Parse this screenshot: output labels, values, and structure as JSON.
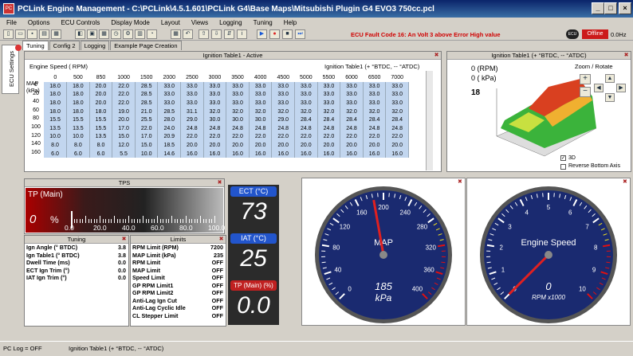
{
  "window": {
    "title": "PCLink Engine Management - C:\\PCLink\\4.5.1.601\\PCLink G4\\Base Maps\\Mitsubishi Plugin G4 EVO3 750cc.pcl",
    "app_icon": "PC"
  },
  "menu": [
    "File",
    "Options",
    "ECU Controls",
    "Display Mode",
    "Layout",
    "Views",
    "Logging",
    "Tuning",
    "Help"
  ],
  "toolbar": {
    "fault": "ECU Fault Code 16: An Volt 3 above Error High value",
    "status": "Offline",
    "rate": "0.0Hz",
    "ecu_icon": "ECU"
  },
  "tabs": [
    "Tuning",
    "Config 2",
    "Logging",
    "Example Page Creation"
  ],
  "side_tab": "ECU Settings",
  "ign_table": {
    "title": "Ignition Table1 - Active",
    "axis_label": "Engine Speed ( RPM)",
    "right_label": "Ignition Table1 (+ °BTDC, -- °ATDC)",
    "load_label": "MAP (kPa)",
    "rpm": [
      "0",
      "500",
      "850",
      "1000",
      "1500",
      "2000",
      "2500",
      "3000",
      "3500",
      "4000",
      "4500",
      "5000",
      "5500",
      "6000",
      "6500",
      "7000"
    ],
    "loads": [
      "0",
      "20",
      "40",
      "60",
      "80",
      "100",
      "120",
      "140",
      "160"
    ],
    "rows": [
      [
        "18.0",
        "18.0",
        "20.0",
        "22.0",
        "28.5",
        "33.0",
        "33.0",
        "33.0",
        "33.0",
        "33.0",
        "33.0",
        "33.0",
        "33.0",
        "33.0",
        "33.0",
        "33.0"
      ],
      [
        "18.0",
        "18.0",
        "20.0",
        "22.0",
        "28.5",
        "33.0",
        "33.0",
        "33.0",
        "33.0",
        "33.0",
        "33.0",
        "33.0",
        "33.0",
        "33.0",
        "33.0",
        "33.0"
      ],
      [
        "18.0",
        "18.0",
        "20.0",
        "22.0",
        "28.5",
        "33.0",
        "33.0",
        "33.0",
        "33.0",
        "33.0",
        "33.0",
        "33.0",
        "33.0",
        "33.0",
        "33.0",
        "33.0"
      ],
      [
        "18.0",
        "18.0",
        "18.0",
        "19.0",
        "21.0",
        "28.5",
        "31.1",
        "32.0",
        "32.0",
        "32.0",
        "32.0",
        "32.0",
        "32.0",
        "32.0",
        "32.0",
        "32.0"
      ],
      [
        "15.5",
        "15.5",
        "15.5",
        "20.0",
        "25.5",
        "28.0",
        "29.0",
        "30.0",
        "30.0",
        "30.0",
        "29.0",
        "28.4",
        "28.4",
        "28.4",
        "28.4",
        "28.4"
      ],
      [
        "13.5",
        "13.5",
        "15.5",
        "17.0",
        "22.0",
        "24.0",
        "24.8",
        "24.8",
        "24.8",
        "24.8",
        "24.8",
        "24.8",
        "24.8",
        "24.8",
        "24.8",
        "24.8"
      ],
      [
        "10.0",
        "10.0",
        "13.5",
        "15.0",
        "17.0",
        "20.9",
        "22.0",
        "22.0",
        "22.0",
        "22.0",
        "22.0",
        "22.0",
        "22.0",
        "22.0",
        "22.0",
        "22.0"
      ],
      [
        "8.0",
        "8.0",
        "8.0",
        "12.0",
        "15.0",
        "18.5",
        "20.0",
        "20.0",
        "20.0",
        "20.0",
        "20.0",
        "20.0",
        "20.0",
        "20.0",
        "20.0",
        "20.0"
      ],
      [
        "6.0",
        "6.0",
        "6.0",
        "5.5",
        "10.0",
        "14.6",
        "16.0",
        "16.0",
        "16.0",
        "16.0",
        "16.0",
        "16.0",
        "16.0",
        "16.0",
        "16.0",
        "16.0"
      ]
    ]
  },
  "view3d": {
    "title": "Ignition Table1 (+ °BTDC, -- °ATDC)",
    "rpm_read": "0 (RPM)",
    "kpa_read": "0 ( kPa)",
    "value_read": "18",
    "zoom_label": "Zoom / Rotate",
    "plus": "+",
    "minus": "−",
    "up": "▲",
    "down": "▼",
    "left": "◀",
    "right": "▶",
    "chk3d": "3D",
    "chk_axis": "Reverse Bottom Axis"
  },
  "tps": {
    "title": "TPS",
    "label": "TP (Main)",
    "value": "0",
    "unit": "%",
    "ticks": [
      "0.0",
      "20.0",
      "40.0",
      "60.0",
      "80.0",
      "100.0"
    ],
    "level": 0
  },
  "tuning": {
    "title": "Tuning",
    "rows": [
      {
        "label": "Ign Angle (° BTDC)",
        "value": "3.8"
      },
      {
        "label": "Ign Table1 (° BTDC)",
        "value": "3.8"
      },
      {
        "label": "Dwell Time (ms)",
        "value": "0.0"
      },
      {
        "label": "ECT Ign Trim (°)",
        "value": "0.0"
      },
      {
        "label": "IAT Ign Trim (°)",
        "value": "0.0"
      }
    ]
  },
  "limits": {
    "title": "Limits",
    "rows": [
      {
        "label": "RPM Limit (RPM)",
        "value": "7200"
      },
      {
        "label": "MAP Limit (kPa)",
        "value": "235"
      },
      {
        "label": "RPM Limit",
        "value": "OFF"
      },
      {
        "label": "MAP Limit",
        "value": "OFF"
      },
      {
        "label": "Speed Limit",
        "value": "OFF"
      },
      {
        "label": "GP RPM Limit1",
        "value": "OFF"
      },
      {
        "label": "GP RPM Limit2",
        "value": "OFF"
      },
      {
        "label": "Anti-Lag Ign Cut",
        "value": "OFF"
      },
      {
        "label": "Anti-Lag Cyclic Idle",
        "value": "OFF"
      },
      {
        "label": "CL Stepper Limit",
        "value": "OFF"
      }
    ]
  },
  "big": {
    "ect_label": "ECT (°C)",
    "ect_value": "73",
    "iat_label": "IAT (°C)",
    "iat_value": "25",
    "tp_label": "TP (Main) (%)",
    "tp_value": "0.0"
  },
  "map_gauge": {
    "name": "MAP",
    "value": "185",
    "unit": "kPa",
    "ticks": [
      "0",
      "40",
      "80",
      "120",
      "160",
      "200",
      "240",
      "280",
      "320",
      "360",
      "400"
    ],
    "max": 400,
    "reading": 185
  },
  "rpm_gauge": {
    "name": "Engine Speed",
    "value": "0",
    "unit": "RPM x1000",
    "ticks": [
      "0",
      "1",
      "2",
      "3",
      "4",
      "5",
      "6",
      "7",
      "8",
      "9",
      "10"
    ],
    "max": 10,
    "reading": 0
  },
  "statusbar": {
    "log": "PC Log = OFF",
    "table": "Ignition Table1 (+ °BTDC, -- °ATDC)"
  }
}
